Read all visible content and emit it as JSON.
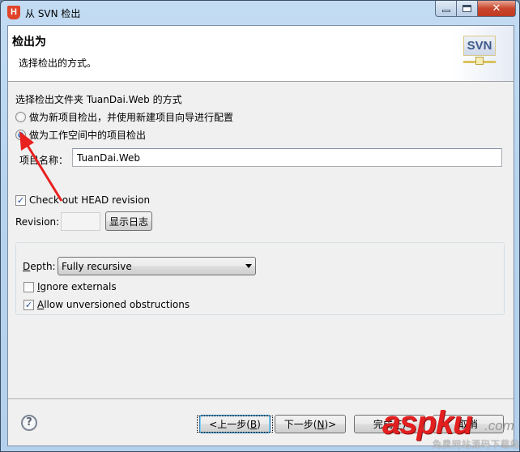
{
  "window": {
    "title": "从 SVN 检出",
    "app_icon": "H",
    "controls": {
      "minimize": "minimize-icon",
      "maximize": "maximize-icon",
      "close_label": "✕"
    }
  },
  "header": {
    "title": "检出为",
    "description": "选择检出的方式。",
    "logo_text": "SVN"
  },
  "main": {
    "prompt": "选择检出文件夹 TuanDai.Web 的方式",
    "options": [
      {
        "label": "做为新项目检出，并使用新建项目向导进行配置",
        "checked": false
      },
      {
        "label": "做为工作空间中的项目检出",
        "checked": true
      }
    ],
    "project_name_label": "项目名称：",
    "project_name_value": "TuanDai.Web",
    "checkout_head": {
      "label": "Check out HEAD revision",
      "checked": true
    },
    "revision_label": "Revision:",
    "revision_value": "",
    "show_log_label": "显示日志",
    "depth": {
      "label_prefix": "D",
      "label_rest": "epth:",
      "selected": "Fully recursive"
    },
    "ignore_externals": {
      "mnemonic": "I",
      "rest": "gnore externals",
      "checked": false
    },
    "allow_unversioned": {
      "mnemonic": "A",
      "rest": "llow unversioned obstructions",
      "checked": true
    }
  },
  "footer": {
    "help_icon": "?",
    "back": {
      "pre": "<上一步(",
      "mnemonic": "B",
      "post": ")"
    },
    "next": {
      "pre": "下一步(",
      "mnemonic": "N",
      "post": ")>"
    },
    "finish": {
      "pre": "完成(",
      "mnemonic": "F",
      "post": ")"
    },
    "cancel": "取消"
  },
  "watermark": {
    "main": "aspku",
    "suffix": ".com",
    "subtitle": "免费网站源码下载站"
  },
  "colors": {
    "annotation_arrow": "#e8201e",
    "titlebar": "#b9d5ef",
    "close_button": "#c9462c"
  }
}
